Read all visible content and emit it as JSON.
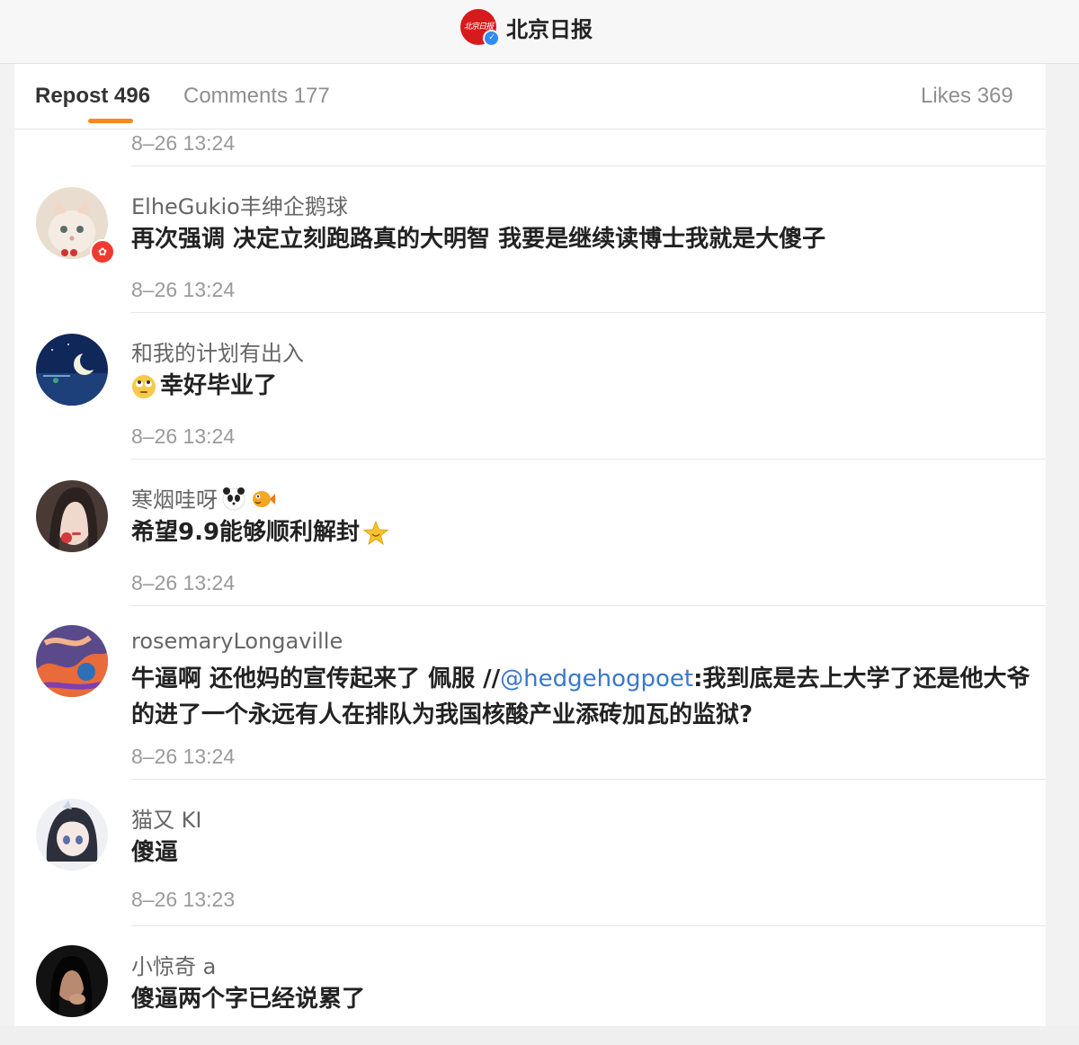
{
  "account": {
    "name": "北京日报",
    "logo_text": "北京日报"
  },
  "tabs": [
    {
      "label": "Repost 496",
      "active": true
    },
    {
      "label": "Comments 177",
      "active": false
    },
    {
      "label": "Likes 369",
      "active": false
    }
  ],
  "feed_stub": {
    "time": "8–26 13:24"
  },
  "reposts": [
    {
      "user": "ElheGukio丰绅企鹅球",
      "text": "再次强调 决定立刻跑路真的大明智 我要是继续读博士我就是大傻子",
      "time": "8–26 13:24",
      "avatar_icon": "cat-avatar",
      "has_badge": true
    },
    {
      "user": "和我的计划有出入",
      "text": "幸好毕业了",
      "emoji": "eye-roll-emoji",
      "time": "8–26 13:24",
      "avatar_icon": "moon-night-avatar"
    },
    {
      "user": "寒烟哇呀",
      "user_emojis": [
        "panda-emoji",
        "fish-emoji"
      ],
      "text": "希望9.9能够顺利解封",
      "trailing_emoji": "star-emoji",
      "time": "8–26 13:24",
      "avatar_icon": "girl-portrait-avatar"
    },
    {
      "user": "rosemaryLongaville",
      "text_before": "牛逼啊 还他妈的宣传起来了 佩服 //",
      "mention": "@hedgehogpoet",
      "text_after": ":我到底是去上大学了还是他大爷的进了一个永远有人在排队为我国核酸产业添砖加瓦的监狱?",
      "time": "8–26 13:24",
      "avatar_icon": "painting-avatar"
    },
    {
      "user": "猫又 KI",
      "text": "傻逼",
      "time": "8–26 13:23",
      "avatar_icon": "anime-girl-avatar"
    },
    {
      "user": "小惊奇 a",
      "text": "傻逼两个字已经说累了",
      "avatar_icon": "dark-portrait-avatar"
    }
  ]
}
